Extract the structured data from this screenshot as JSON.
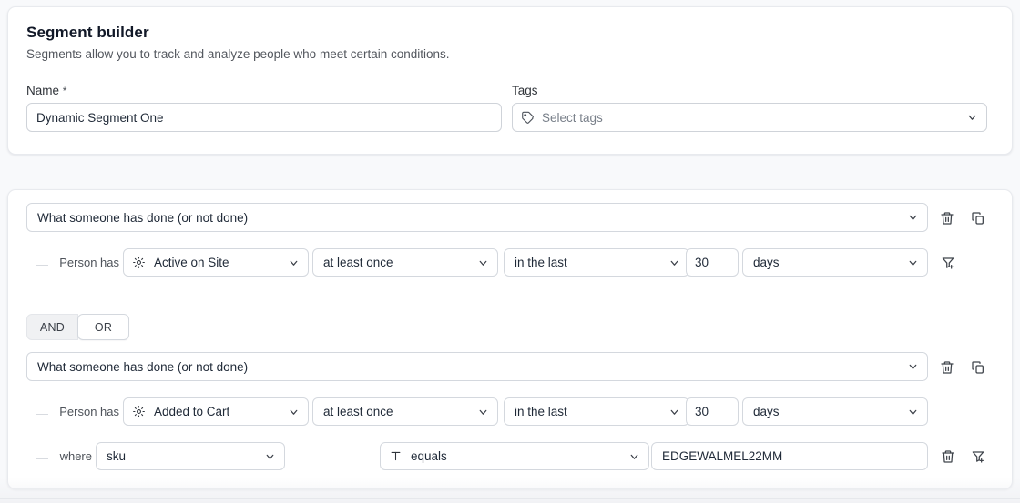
{
  "header": {
    "title": "Segment builder",
    "subtitle": "Segments allow you to track and analyze people who meet certain conditions.",
    "name_label": "Name",
    "name_required_mark": "*",
    "name_value": "Dynamic Segment One",
    "tags_label": "Tags",
    "tags_placeholder": "Select tags",
    "tags_icon": "tag-icon",
    "chevron_icon": "chevron-down-icon"
  },
  "conditions": {
    "group_operator": {
      "options": [
        "AND",
        "OR"
      ],
      "selected": "OR"
    },
    "blocks": [
      {
        "type_label": "What someone has done (or not done)",
        "delete_icon": "trash-icon",
        "duplicate_icon": "copy-icon",
        "rows": [
          {
            "prefix": "Person has",
            "event": "Active on Site",
            "event_icon": "event-gear-icon",
            "frequency": "at least once",
            "timeframe": "in the last",
            "amount": "30",
            "unit": "days",
            "add_filter_icon": "filter-plus-icon"
          }
        ]
      },
      {
        "type_label": "What someone has done (or not done)",
        "delete_icon": "trash-icon",
        "duplicate_icon": "copy-icon",
        "rows": [
          {
            "prefix": "Person has",
            "event": "Added to Cart",
            "event_icon": "event-gear-icon",
            "frequency": "at least once",
            "timeframe": "in the last",
            "amount": "30",
            "unit": "days"
          }
        ],
        "filter_row": {
          "prefix": "where",
          "property": "sku",
          "operator": "equals",
          "operator_icon": "text-type-icon",
          "value": "EDGEWALMEL22MM",
          "delete_icon": "trash-icon",
          "add_filter_icon": "filter-plus-icon"
        }
      }
    ]
  },
  "colors": {
    "page_background": "#f8f9fb",
    "card_background": "#ffffff",
    "border": "#d4d8de",
    "text": "#1f2937",
    "muted_text": "#787f89"
  }
}
